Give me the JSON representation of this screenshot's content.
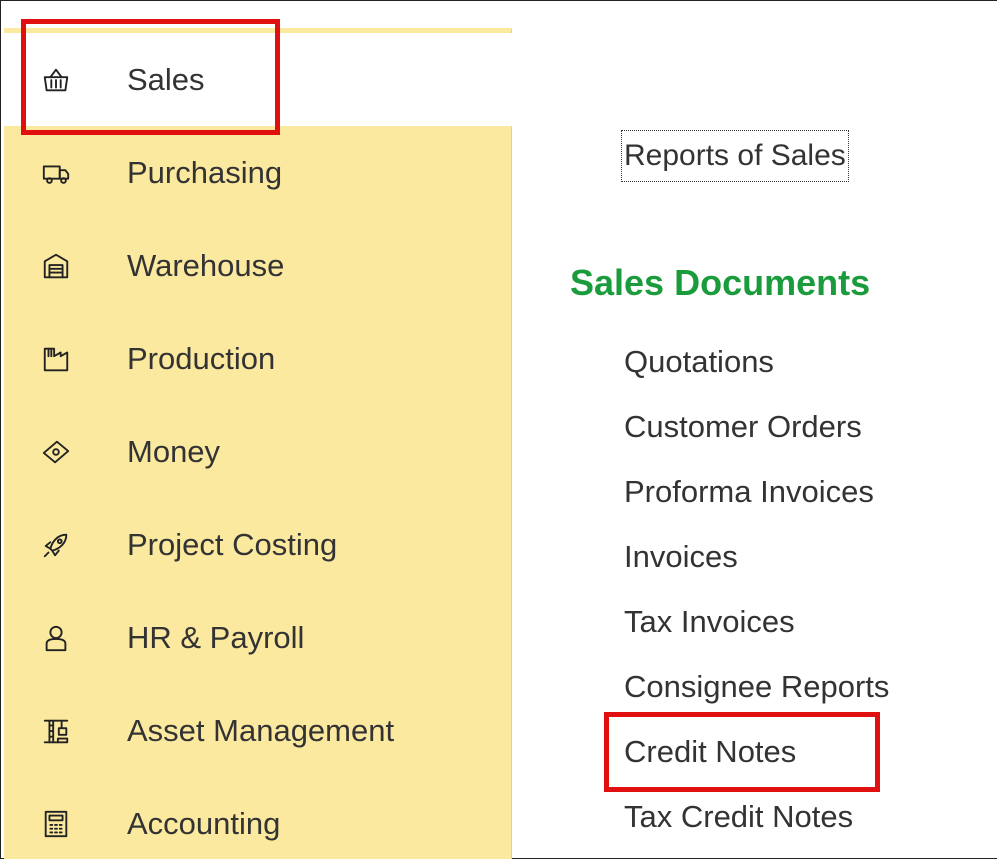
{
  "sidebar": {
    "items": [
      {
        "label": "Sales",
        "icon": "basket-icon",
        "active": true
      },
      {
        "label": "Purchasing",
        "icon": "truck-icon"
      },
      {
        "label": "Warehouse",
        "icon": "warehouse-icon"
      },
      {
        "label": "Production",
        "icon": "factory-icon"
      },
      {
        "label": "Money",
        "icon": "money-icon"
      },
      {
        "label": "Project Costing",
        "icon": "rocket-icon"
      },
      {
        "label": "HR & Payroll",
        "icon": "person-icon"
      },
      {
        "label": "Asset Management",
        "icon": "crane-icon"
      },
      {
        "label": "Accounting",
        "icon": "calculator-icon"
      }
    ]
  },
  "main": {
    "reports_link": "Reports of Sales",
    "section_title": "Sales Documents",
    "documents": [
      "Quotations",
      "Customer Orders",
      "Proforma Invoices",
      "Invoices",
      "Tax Invoices",
      "Consignee Reports",
      "Credit Notes",
      "Tax Credit Notes"
    ]
  },
  "colors": {
    "sidebar_bg": "#fbe9a0",
    "section_title": "#1a9b3c",
    "highlight": "#e01010"
  }
}
